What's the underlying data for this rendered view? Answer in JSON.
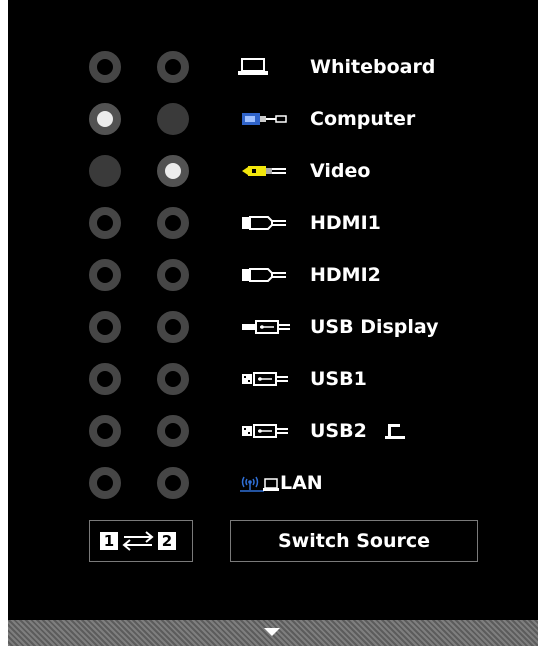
{
  "sources": [
    {
      "label": "Whiteboard",
      "col1": "off",
      "col2": "off",
      "icon": "whiteboard-icon"
    },
    {
      "label": "Computer",
      "col1": "on",
      "col2": "disabled",
      "icon": "computer-vga-icon"
    },
    {
      "label": "Video",
      "col1": "disabled",
      "col2": "on",
      "icon": "video-rca-icon"
    },
    {
      "label": "HDMI1",
      "col1": "off",
      "col2": "off",
      "icon": "hdmi-icon"
    },
    {
      "label": "HDMI2",
      "col1": "off",
      "col2": "off",
      "icon": "hdmi-icon"
    },
    {
      "label": "USB Display",
      "col1": "off",
      "col2": "off",
      "icon": "usb-display-icon"
    },
    {
      "label": "USB1",
      "col1": "off",
      "col2": "off",
      "icon": "usb-icon"
    },
    {
      "label": "USB2",
      "col1": "off",
      "col2": "off",
      "icon": "usb-icon"
    },
    {
      "label": "LAN",
      "col1": "off",
      "col2": "off",
      "icon": "lan-icon"
    }
  ],
  "swap": {
    "left": "1",
    "right": "2"
  },
  "switch_source_label": "Switch Source",
  "colors": {
    "background": "#000000",
    "radio_ring": "#464646",
    "radio_selected": "#ececec",
    "vga_blue": "#2f63c9",
    "video_yellow": "#f2e60c",
    "lan_blue": "#2f6fd6"
  }
}
